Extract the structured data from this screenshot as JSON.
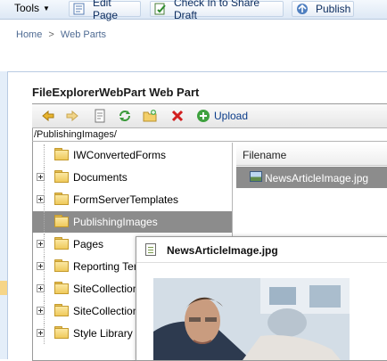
{
  "toolbar": {
    "tools_label": "Tools",
    "edit_page_label": "Edit Page",
    "check_in_label": "Check In to Share Draft",
    "publish_label": "Publish"
  },
  "breadcrumb": {
    "home": "Home",
    "separator": ">",
    "current": "Web Parts"
  },
  "webpart": {
    "title": "FileExplorerWebPart Web Part",
    "upload_label": "Upload",
    "current_path": "/PublishingImages/",
    "tree": [
      {
        "label": "IWConvertedForms",
        "expandable": false,
        "selected": false
      },
      {
        "label": "Documents",
        "expandable": true,
        "selected": false
      },
      {
        "label": "FormServerTemplates",
        "expandable": true,
        "selected": false
      },
      {
        "label": "PublishingImages",
        "expandable": false,
        "selected": true
      },
      {
        "label": "Pages",
        "expandable": true,
        "selected": false
      },
      {
        "label": "Reporting Ter",
        "expandable": true,
        "selected": false
      },
      {
        "label": "SiteCollection",
        "expandable": true,
        "selected": false
      },
      {
        "label": "SiteCollection",
        "expandable": true,
        "selected": false
      },
      {
        "label": "Style Library",
        "expandable": true,
        "selected": false
      }
    ],
    "file_list": {
      "header": "Filename",
      "files": [
        "NewsArticleImage.jpg"
      ]
    }
  },
  "preview": {
    "title": "NewsArticleImage.jpg"
  },
  "colors": {
    "selection": "#8c8c8c",
    "link": "#4f6b93",
    "folder": "#efc95b"
  }
}
